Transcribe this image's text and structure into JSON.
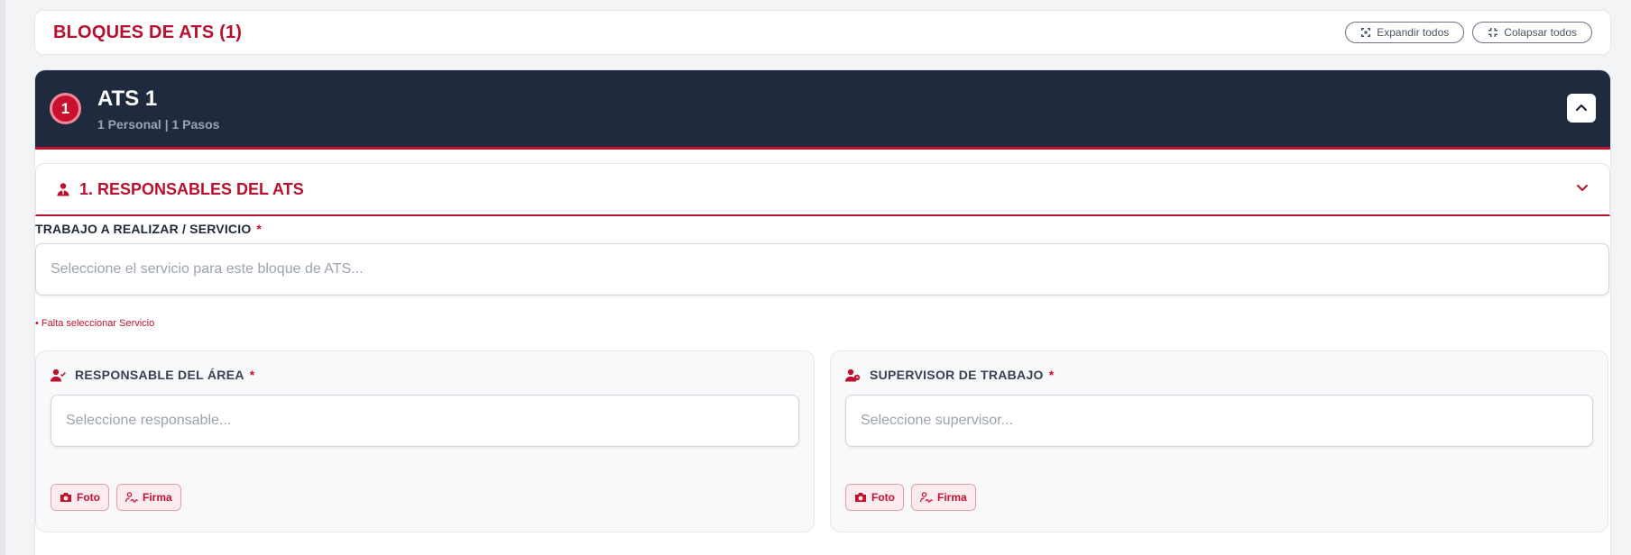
{
  "blocks": {
    "title": "BLOQUES DE ATS (1)",
    "expand_label": "Expandir todos",
    "collapse_label": "Colapsar todos"
  },
  "ats": {
    "number": "1",
    "name": "ATS 1",
    "summary": "1 Personal | 1 Pasos"
  },
  "section": {
    "title": "1. RESPONSABLES DEL ATS"
  },
  "service": {
    "label": "TRABAJO A REALIZAR / SERVICIO",
    "required_mark": "*",
    "placeholder": "Seleccione el servicio para este bloque de ATS...",
    "error": "• Falta seleccionar Servicio"
  },
  "area_responsible": {
    "label": "RESPONSABLE DEL ÁREA",
    "required_mark": "*",
    "placeholder": "Seleccione responsable...",
    "photo_label": "Foto",
    "sign_label": "Firma"
  },
  "work_supervisor": {
    "label": "SUPERVISOR DE TRABAJO",
    "required_mark": "*",
    "placeholder": "Seleccione supervisor...",
    "photo_label": "Foto",
    "sign_label": "Firma"
  },
  "colors": {
    "brand_red": "#b8102e",
    "banner_navy": "#1f2a3f"
  }
}
